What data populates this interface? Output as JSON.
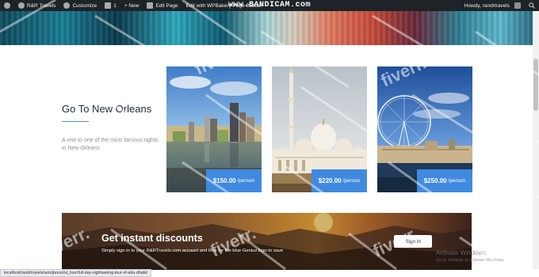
{
  "adminbar": {
    "site_name": "R&R Travels",
    "customize": "Customize",
    "comments_count": "1",
    "new": "+ New",
    "edit_page": "Edit Page",
    "wpbakery": "Edit with WPBakery Page Builder",
    "howdy": "Howdy, randrtravels"
  },
  "recording_watermark": "www.BANDICAM.com",
  "section": {
    "title": "Go To New Orleans",
    "description": "A visit to one of the most famous sights in New Orleans"
  },
  "tours": [
    {
      "price": "$150.00",
      "unit": "/person"
    },
    {
      "price": "$220.00",
      "unit": "/person"
    },
    {
      "price": "$250.00",
      "unit": "/person"
    }
  ],
  "banner": {
    "title": "Get instant discounts",
    "description": "Simply sign in to your R&RTravels.com account and look for the blue Genius logo to save",
    "button": "Sign in"
  },
  "os_notice": {
    "title": "Activate Windows",
    "subtitle": "Go to Settings to activate Windows."
  },
  "status_url": "localhost/randrtravels/wordpress/st_tour/full-day-sightseeing-tour-of-abu-dhabi/",
  "colors": {
    "accent": "#3f8ae0",
    "admin_bar": "#1d2327",
    "title": "#1f2a38"
  }
}
